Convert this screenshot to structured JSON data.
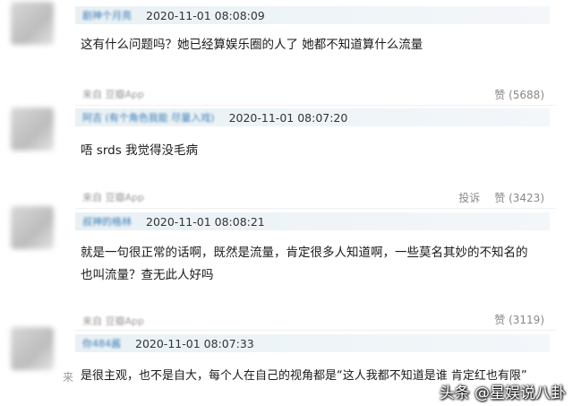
{
  "comments": [
    {
      "username": "剧神个月亮",
      "time": "2020-11-01 08:08:09",
      "text": "这有什么问题吗？她已经算娱乐圈的人了 她都不知道算什么流量",
      "from": "来自 豆瓣App",
      "like": "赞 (5688)"
    },
    {
      "username": "阿吉 (有个角色我能 尽量入戏)",
      "time": "2020-11-01 08:07:20",
      "text": "唔 srds 我觉得没毛病",
      "from": "来自 豆瓣App",
      "report": "投诉",
      "like": "赞 (3423)"
    },
    {
      "username": "叔神的格林",
      "time": "2020-11-01 08:08:21",
      "text": "就是一句很正常的话啊，既然是流量，肯定很多人知道啊，一些莫名其妙的不知名的也叫流量？查无此人好吗",
      "from": "来自 豆瓣App",
      "like": "赞 (3119)"
    },
    {
      "username": "你484酱",
      "time": "2020-11-01 08:07:33",
      "text": "是很主观，也不是自大，每个人在自己的视角都是“这人我都不知道是谁 肯定红也有限”"
    }
  ],
  "side_char": "来",
  "watermark": "头条 @星娱说八卦"
}
